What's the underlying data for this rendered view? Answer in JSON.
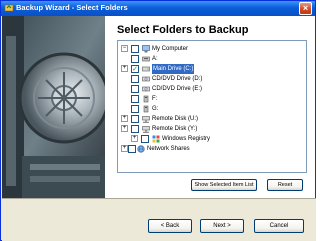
{
  "window": {
    "title": "Backup Wizard - Select Folders",
    "close_glyph": "×"
  },
  "page": {
    "heading": "Select Folders to Backup"
  },
  "tree": [
    {
      "label": "My Computer",
      "expander": "−",
      "checked": false,
      "icon": "computer-icon",
      "selected": false
    },
    {
      "label": "A:",
      "expander": "",
      "checked": false,
      "icon": "floppy-drive-icon",
      "selected": false
    },
    {
      "label": "Main Drive (C:)",
      "expander": "+",
      "checked": true,
      "icon": "hard-drive-icon",
      "selected": true
    },
    {
      "label": "CD/DVD Drive (D:)",
      "expander": "",
      "checked": false,
      "icon": "cd-drive-icon",
      "selected": false
    },
    {
      "label": "CD/DVD Drive (E:)",
      "expander": "",
      "checked": false,
      "icon": "cd-drive-icon",
      "selected": false
    },
    {
      "label": "F:",
      "expander": "",
      "checked": false,
      "icon": "removable-drive-icon",
      "selected": false
    },
    {
      "label": "G:",
      "expander": "",
      "checked": false,
      "icon": "removable-drive-icon",
      "selected": false
    },
    {
      "label": "Remote Disk (U:)",
      "expander": "+",
      "checked": false,
      "icon": "network-drive-icon",
      "selected": false
    },
    {
      "label": "Remote Disk (Y:)",
      "expander": "+",
      "checked": false,
      "icon": "network-drive-icon",
      "selected": false
    },
    {
      "label": "Windows Registry",
      "expander": "+",
      "checked": false,
      "icon": "registry-icon",
      "selected": false
    },
    {
      "label": "Network Shares",
      "expander": "+",
      "checked": false,
      "icon": "network-icon",
      "selected": false
    }
  ],
  "buttons": {
    "show_selected": "Show Selected Item List",
    "reset": "Reset",
    "back": "< Back",
    "next": "Next >",
    "cancel": "Cancel"
  },
  "colors": {
    "selection": "#316ac5",
    "titlebar": "#0a5ed7",
    "face": "#ece9d8"
  }
}
